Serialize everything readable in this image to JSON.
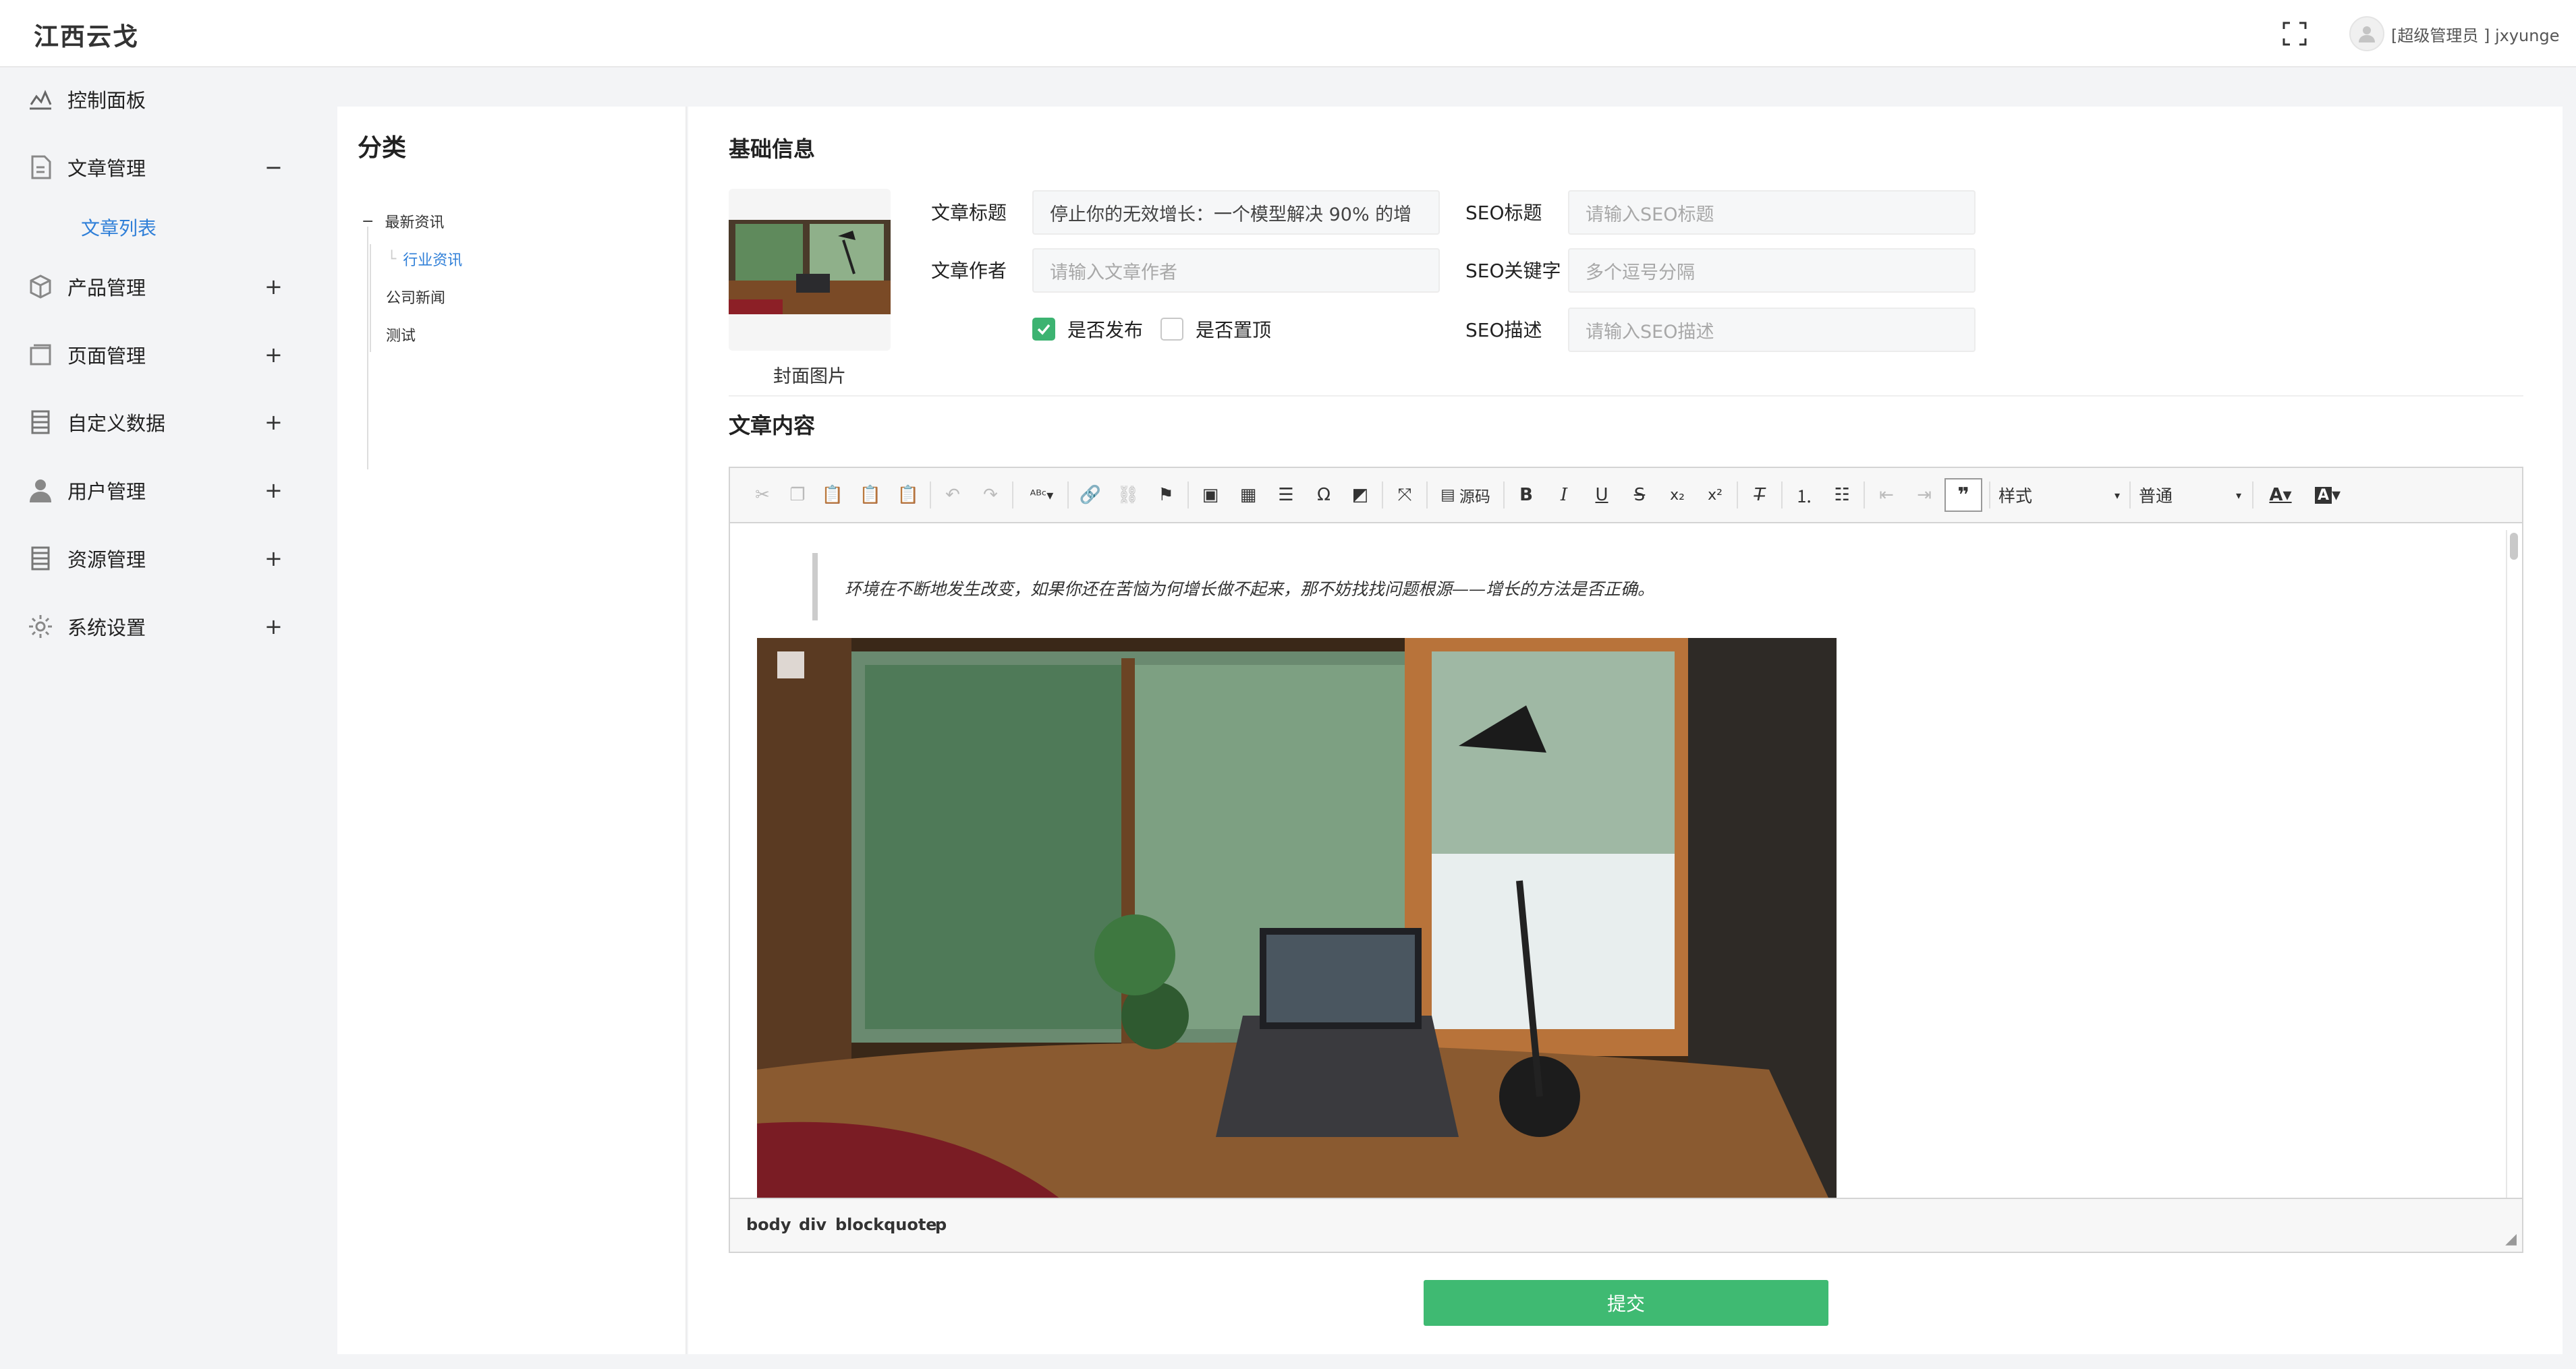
{
  "header": {
    "brand": "江西云戈",
    "user_label": "[超级管理员 ] jxyunge"
  },
  "sidebar": {
    "items": [
      {
        "label": "控制面板",
        "icon": "dashboard-icon",
        "toggle": ""
      },
      {
        "label": "文章管理",
        "icon": "document-icon",
        "toggle": "−"
      },
      {
        "label": "产品管理",
        "icon": "box-icon",
        "toggle": "+"
      },
      {
        "label": "页面管理",
        "icon": "page-icon",
        "toggle": "+"
      },
      {
        "label": "自定义数据",
        "icon": "database-icon",
        "toggle": "+"
      },
      {
        "label": "用户管理",
        "icon": "user-icon",
        "toggle": "+"
      },
      {
        "label": "资源管理",
        "icon": "resource-icon",
        "toggle": "+"
      },
      {
        "label": "系统设置",
        "icon": "gear-icon",
        "toggle": "+"
      }
    ],
    "sub_item": "文章列表"
  },
  "category": {
    "title": "分类",
    "tree": [
      {
        "label": "最新资讯",
        "prefix": "−",
        "level": 0
      },
      {
        "label": "行业资讯",
        "prefix": "└",
        "level": 1,
        "active": true
      },
      {
        "label": "公司新闻",
        "prefix": "",
        "level": 0
      },
      {
        "label": "测试",
        "prefix": "",
        "level": 0
      }
    ]
  },
  "form": {
    "basic_title": "基础信息",
    "cover_label": "封面图片",
    "title_label": "文章标题",
    "title_value": "停止你的无效增长：一个模型解决 90% 的增",
    "author_label": "文章作者",
    "author_placeholder": "请输入文章作者",
    "publish_label": "是否发布",
    "publish_checked": true,
    "top_label": "是否置顶",
    "top_checked": false,
    "seo_title_label": "SEO标题",
    "seo_title_placeholder": "请输入SEO标题",
    "seo_keywords_label": "SEO关键字",
    "seo_keywords_placeholder": "多个逗号分隔",
    "seo_desc_label": "SEO描述",
    "seo_desc_placeholder": "请输入SEO描述",
    "content_title": "文章内容",
    "submit_label": "提交"
  },
  "editor": {
    "source_label": "源码",
    "style_select": "样式",
    "format_select": "普通",
    "quote_text": "环境在不断地发生改变，如果你还在苦恼为何增长做不起来，那不妨找找问题根源——增长的方法是否正确。",
    "path": [
      "body",
      "div",
      "blockquote",
      "p"
    ]
  },
  "colors": {
    "accent": "#2f7fd8",
    "submit": "#3fba72",
    "checkbox_on": "#3cb371"
  }
}
